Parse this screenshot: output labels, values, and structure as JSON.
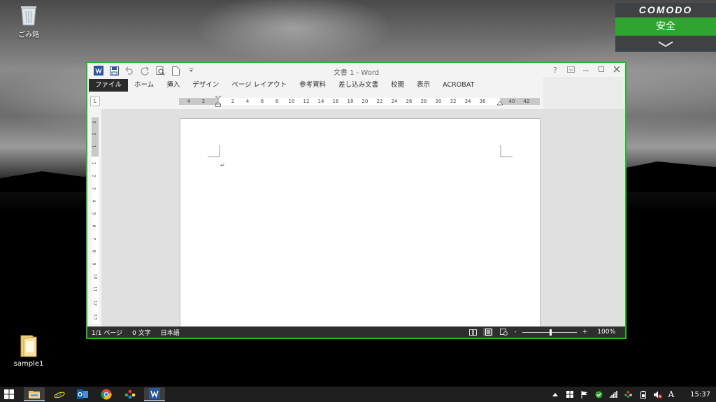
{
  "desktop": {
    "icons": [
      {
        "name": "recycle-bin",
        "label": "ごみ箱"
      },
      {
        "name": "sample-folder",
        "label": "sample1"
      }
    ]
  },
  "comodo": {
    "brand": "COMODO",
    "status": "安全",
    "status_color": "#2fa52f"
  },
  "word": {
    "title": "文書 1 - Word",
    "help": "?",
    "tabs": [
      "ファイル",
      "ホーム",
      "挿入",
      "デザイン",
      "ページ レイアウト",
      "参考資料",
      "差し込み文書",
      "校閲",
      "表示",
      "ACROBAT"
    ],
    "ruler_corner": "L",
    "ruler_numbers": [
      "4",
      "2",
      "2",
      "4",
      "6",
      "8",
      "10",
      "12",
      "14",
      "16",
      "18",
      "20",
      "22",
      "24",
      "26",
      "28",
      "30",
      "32",
      "34",
      "36",
      "40",
      "42"
    ],
    "vruler_numbers": [
      "3",
      "2",
      "1",
      "1",
      "2",
      "3",
      "4",
      "5",
      "6",
      "7",
      "8",
      "9",
      "10",
      "11",
      "12",
      "13"
    ],
    "paragraph_mark": "↵",
    "status": {
      "page": "1/1 ページ",
      "words": "0 文字",
      "language": "日本語",
      "zoom_minus": "-",
      "zoom_plus": "+",
      "zoom": "100%"
    },
    "accent": "#2b579a",
    "frame_color": "#2bb52b"
  },
  "taskbar": {
    "apps": [
      "file-explorer",
      "internet-explorer",
      "outlook",
      "chrome",
      "color-app",
      "word"
    ],
    "tray_text": "A",
    "clock": "15:37"
  }
}
